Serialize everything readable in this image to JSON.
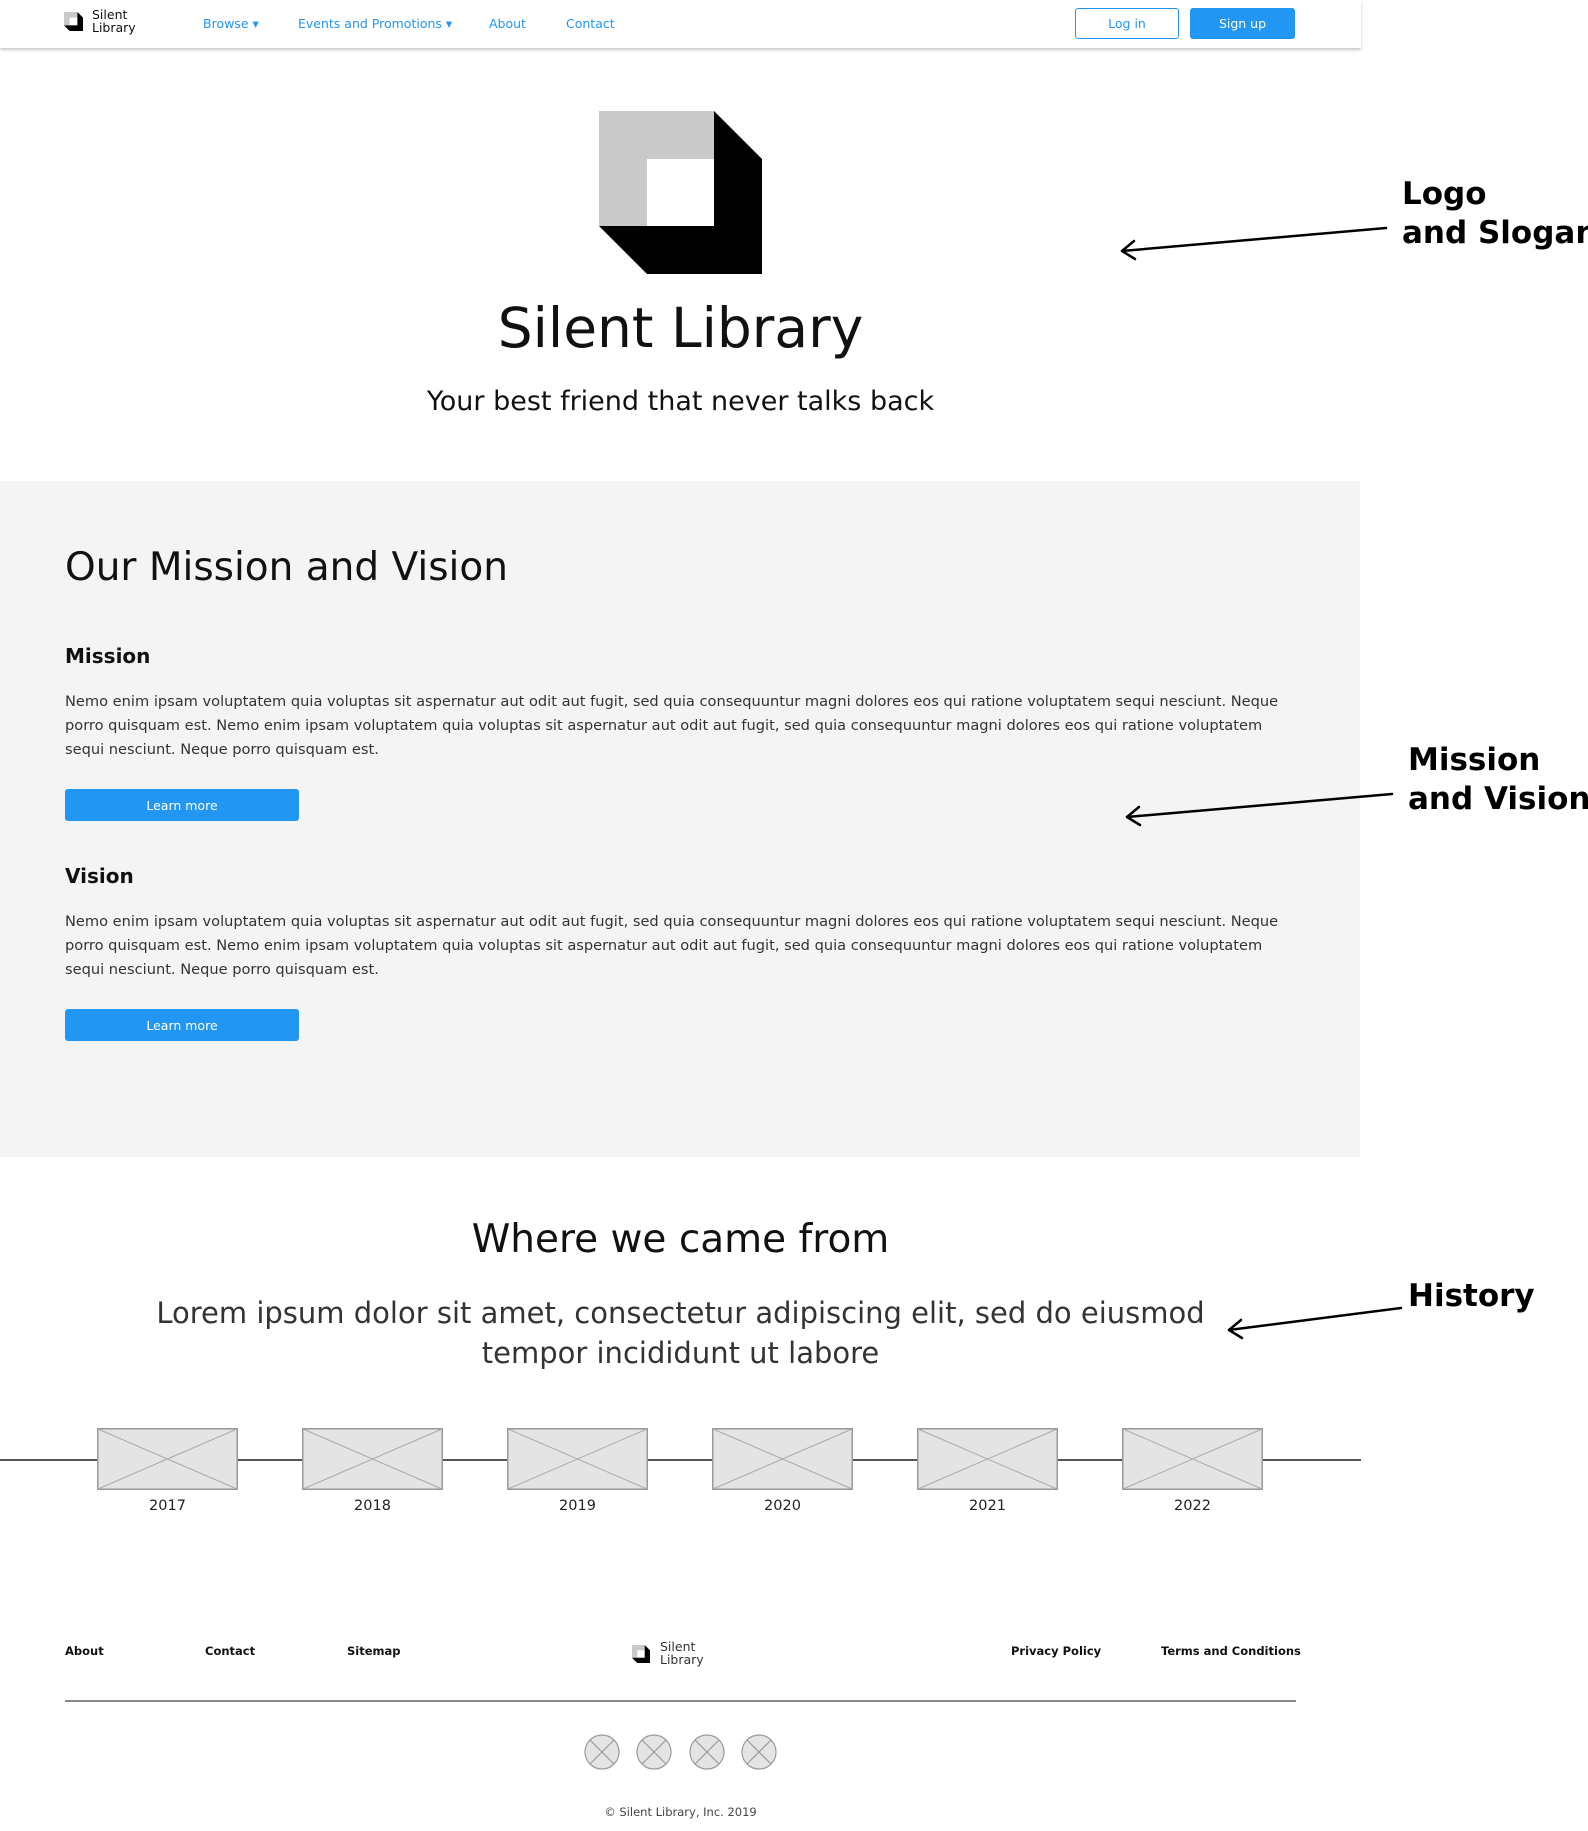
{
  "nav": {
    "logo_line1": "Silent",
    "logo_line2": "Library",
    "links": [
      "Browse ▾",
      "Events and Promotions ▾",
      "About",
      "Contact"
    ],
    "login": "Log in",
    "signup": "Sign up"
  },
  "hero": {
    "title": "Silent Library",
    "slogan": "Your best friend that never talks back"
  },
  "mission": {
    "heading": "Our Mission and Vision",
    "mission_title": "Mission",
    "mission_text": "Nemo enim ipsam voluptatem quia voluptas sit aspernatur aut odit aut fugit, sed quia consequuntur magni dolores eos qui ratione voluptatem sequi nesciunt. Neque porro quisquam est. Nemo enim ipsam voluptatem quia voluptas sit aspernatur aut odit aut fugit, sed quia consequuntur magni dolores eos qui ratione voluptatem sequi nesciunt. Neque porro quisquam est.",
    "vision_title": "Vision",
    "vision_text": "Nemo enim ipsam voluptatem quia voluptas sit aspernatur aut odit aut fugit, sed quia consequuntur magni dolores eos qui ratione voluptatem sequi nesciunt. Neque porro quisquam est. Nemo enim ipsam voluptatem quia voluptas sit aspernatur aut odit aut fugit, sed quia consequuntur magni dolores eos qui ratione voluptatem sequi nesciunt. Neque porro quisquam est.",
    "learn_more": "Learn more"
  },
  "history": {
    "heading": "Where we came from",
    "text": "Lorem ipsum dolor sit amet, consectetur adipiscing elit, sed do eiusmod tempor incididunt ut labore",
    "years": [
      "2017",
      "2018",
      "2019",
      "2020",
      "2021",
      "2022"
    ]
  },
  "footer": {
    "links_left": [
      "About",
      "Contact",
      "Sitemap"
    ],
    "links_right": [
      "Privacy Policy",
      "Terms and Conditions"
    ],
    "logo_line1": "Silent",
    "logo_line2": "Library",
    "copyright": "© Silent Library, Inc. 2019"
  },
  "annotations": {
    "logo_line1": "Logo",
    "logo_line2": "and Slogan",
    "mission_line1": "Mission",
    "mission_line2": "and Vision",
    "history": "History"
  },
  "colors": {
    "accent": "#2196f3",
    "section_bg": "#f4f4f4"
  }
}
